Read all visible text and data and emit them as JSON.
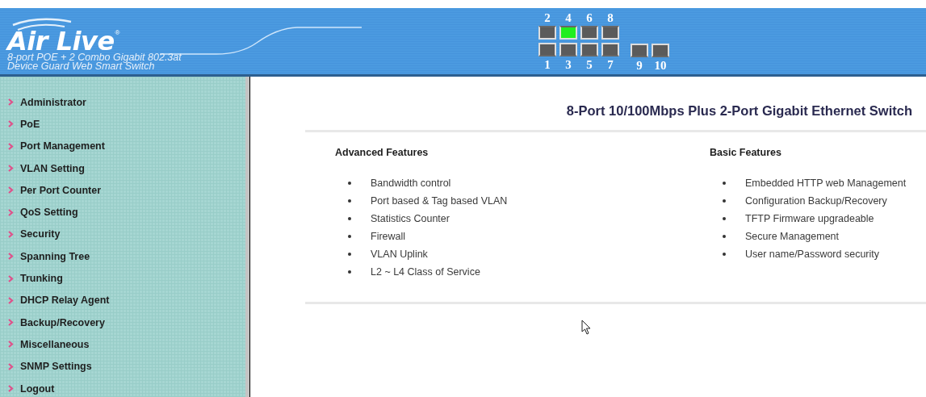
{
  "header": {
    "logo": "Air Live",
    "logo_mark": "®",
    "subtitle_lines": [
      "8-port POE + 2 Combo Gigabit 802.3at",
      "Device Guard Web Smart Switch"
    ],
    "port_groups": [
      {
        "columns": [
          {
            "upper": {
              "label": "2",
              "on": false
            },
            "lower": {
              "label": "1",
              "on": false
            }
          },
          {
            "upper": {
              "label": "4",
              "on": true
            },
            "lower": {
              "label": "3",
              "on": false
            }
          },
          {
            "upper": {
              "label": "6",
              "on": false
            },
            "lower": {
              "label": "5",
              "on": false
            }
          },
          {
            "upper": {
              "label": "8",
              "on": false
            },
            "lower": {
              "label": "7",
              "on": false
            }
          }
        ]
      },
      {
        "columns": [
          {
            "lower": {
              "label": "9",
              "on": false
            }
          },
          {
            "lower": {
              "label": "10",
              "on": false
            }
          }
        ]
      }
    ]
  },
  "sidebar": {
    "items": [
      "Administrator",
      "PoE",
      "Port Management",
      "VLAN Setting",
      "Per Port Counter",
      "QoS Setting",
      "Security",
      "Spanning Tree",
      "Trunking",
      "DHCP Relay Agent",
      "Backup/Recovery",
      "Miscellaneous",
      "SNMP Settings",
      "Logout"
    ]
  },
  "content": {
    "title": "8-Port 10/100Mbps Plus 2-Port Gigabit Ethernet Switch",
    "sections": [
      {
        "heading": "Advanced Features",
        "items": [
          "Bandwidth control",
          "Port based & Tag based VLAN",
          "Statistics Counter",
          "Firewall",
          "VLAN Uplink",
          "L2 ~ L4 Class of Service"
        ]
      },
      {
        "heading": "Basic Features",
        "items": [
          "Embedded HTTP web Management",
          "Configuration Backup/Recovery",
          "TFTP Firmware upgradeable",
          "Secure Management",
          "User name/Password security"
        ]
      }
    ]
  }
}
